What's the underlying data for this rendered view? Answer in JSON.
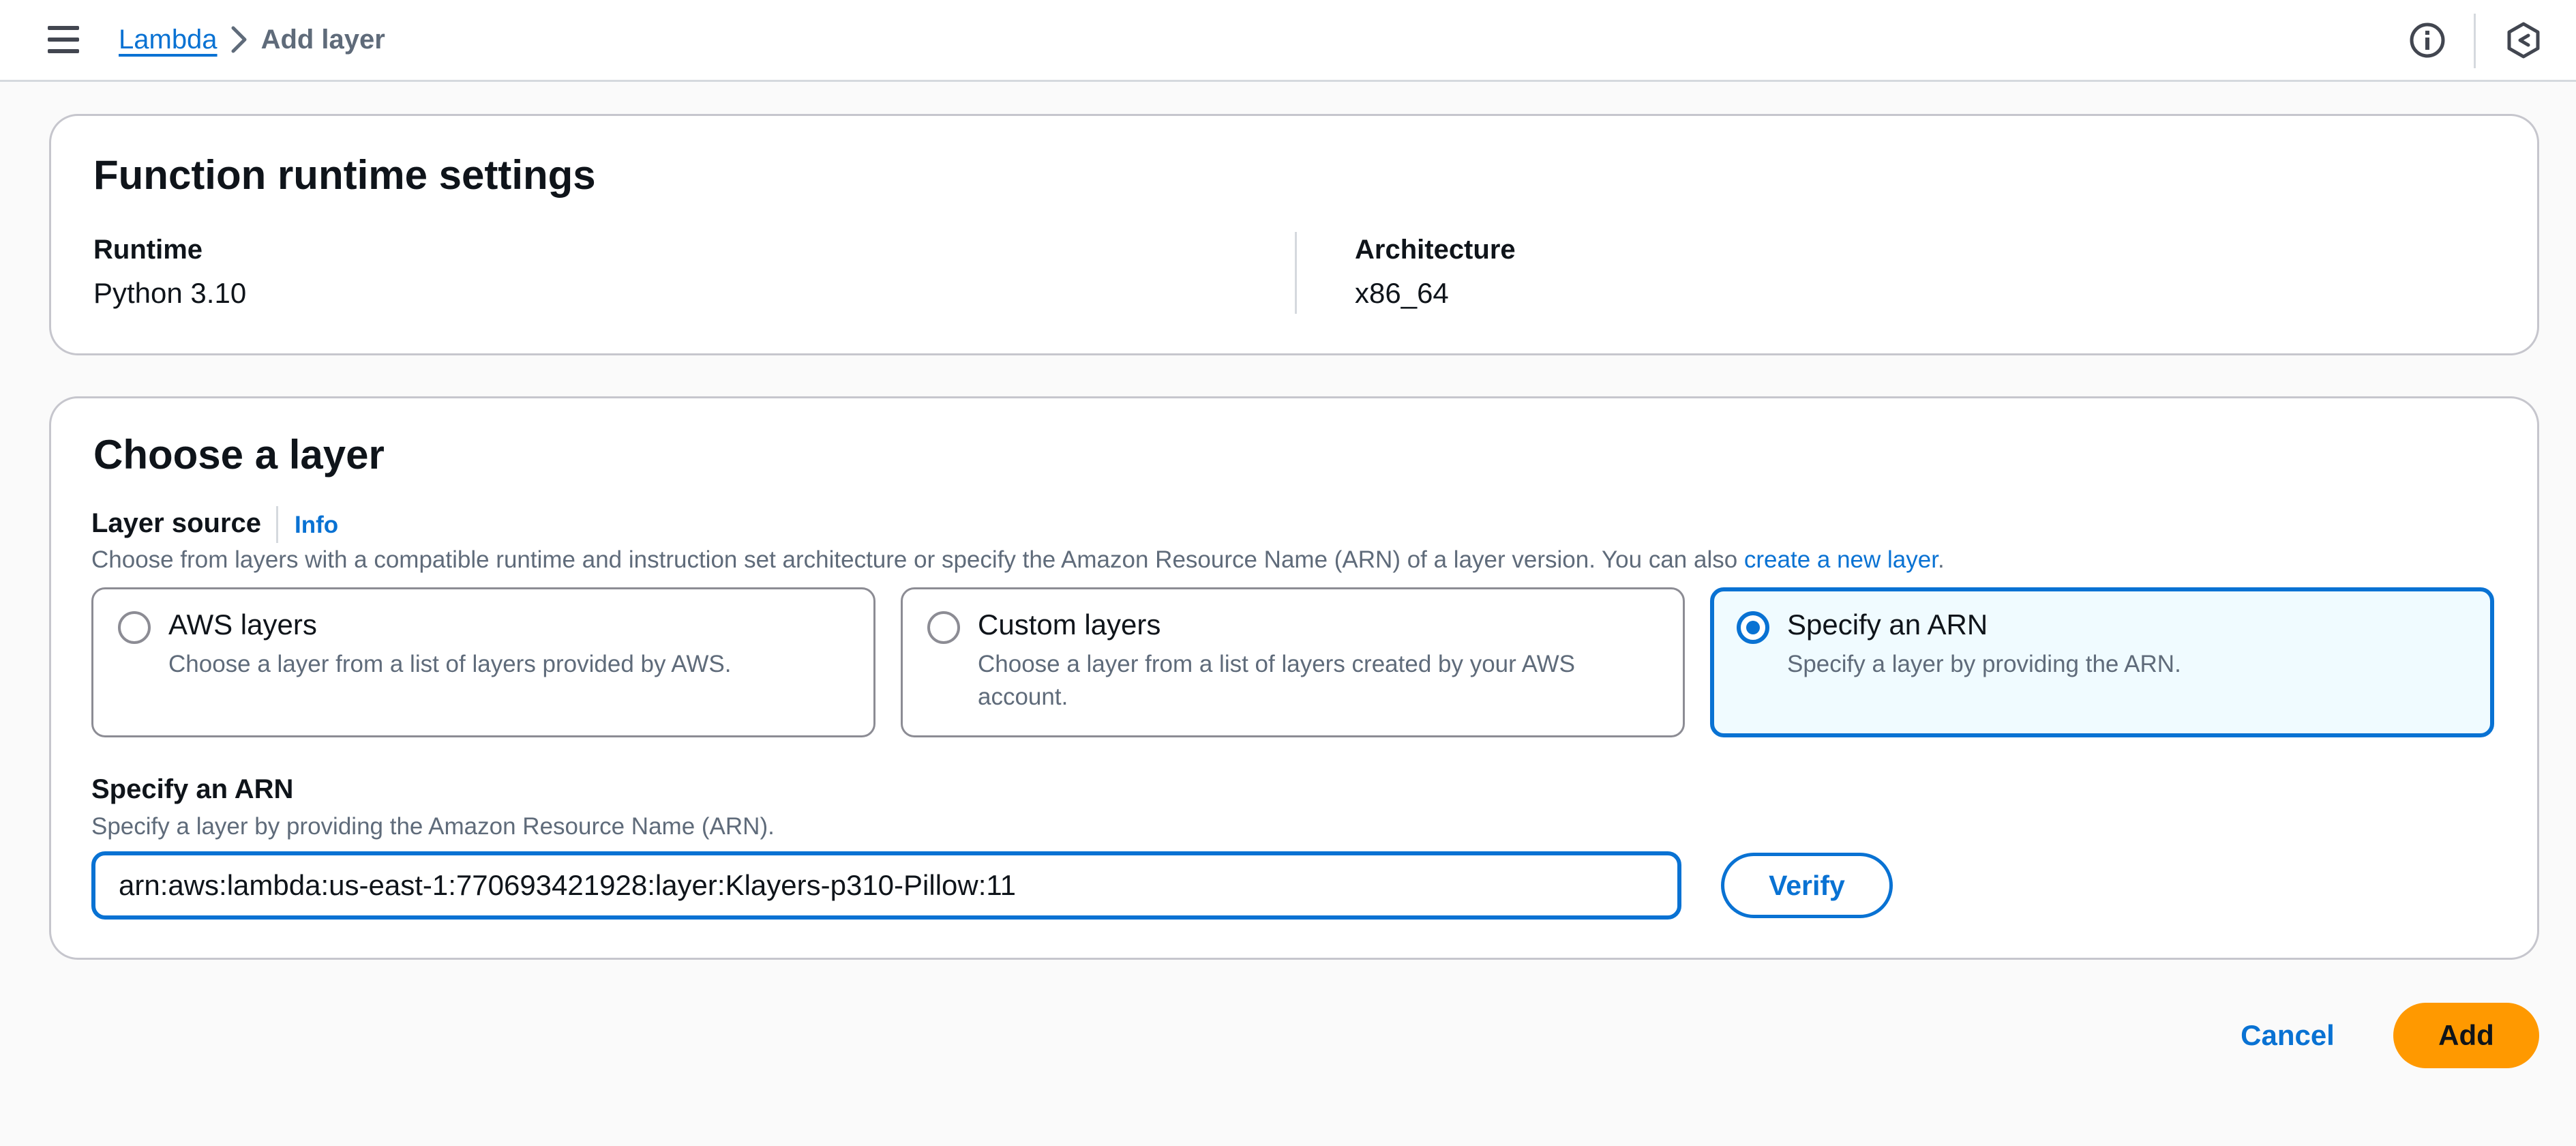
{
  "nav": {
    "menu_icon": "hamburger-menu-icon",
    "breadcrumb": {
      "parent": "Lambda",
      "current": "Add layer"
    },
    "info_icon": "info-icon",
    "cloudshell_icon": "hexagon-icon"
  },
  "runtime_settings": {
    "title": "Function runtime settings",
    "runtime_label": "Runtime",
    "runtime_value": "Python 3.10",
    "architecture_label": "Architecture",
    "architecture_value": "x86_64"
  },
  "choose_layer": {
    "title": "Choose a layer",
    "layer_source_label": "Layer source",
    "info_link": "Info",
    "description": "Choose from layers with a compatible runtime and instruction set architecture or specify the Amazon Resource Name (ARN) of a layer version. You can also ",
    "create_link": "create a new layer",
    "description_end": ".",
    "options": [
      {
        "title": "AWS layers",
        "description": "Choose a layer from a list of layers provided by AWS.",
        "selected": false
      },
      {
        "title": "Custom layers",
        "description": "Choose a layer from a list of layers created by your AWS account.",
        "selected": false
      },
      {
        "title": "Specify an ARN",
        "description": "Specify a layer by providing the ARN.",
        "selected": true
      }
    ],
    "arn_label": "Specify an ARN",
    "arn_help": "Specify a layer by providing the Amazon Resource Name (ARN).",
    "arn_value": "arn:aws:lambda:us-east-1:770693421928:layer:Klayers-p310-Pillow:11",
    "verify_label": "Verify"
  },
  "actions": {
    "cancel_label": "Cancel",
    "add_label": "Add"
  },
  "colors": {
    "accent": "#0972d3",
    "primary_button": "#ff9900",
    "selected_tile_bg": "#f0fbff"
  }
}
